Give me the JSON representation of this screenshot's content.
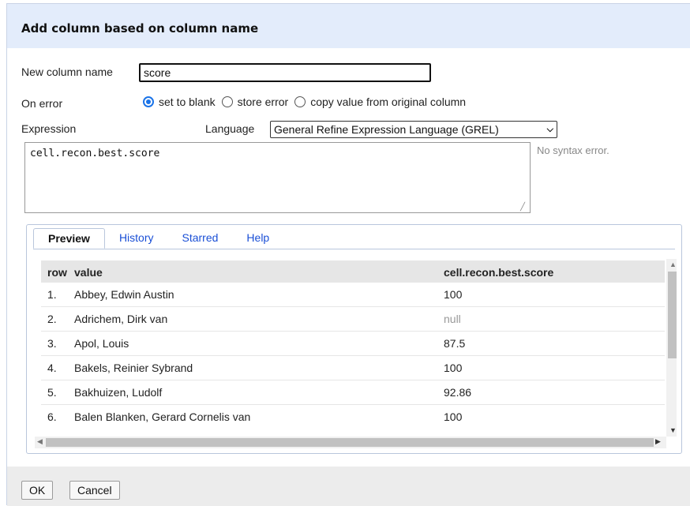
{
  "dialog": {
    "title": "Add column based on column name"
  },
  "form": {
    "new_column_label": "New column name",
    "new_column_value": "score",
    "on_error_label": "On error",
    "on_error_options": [
      "set to blank",
      "store error",
      "copy value from original column"
    ],
    "on_error_selected": "set to blank",
    "expression_label": "Expression",
    "language_label": "Language",
    "language_value": "General Refine Expression Language (GREL)",
    "expression_value": "cell.recon.best.score",
    "syntax_status": "No syntax error."
  },
  "tabs": [
    {
      "label": "Preview",
      "active": true
    },
    {
      "label": "History",
      "active": false
    },
    {
      "label": "Starred",
      "active": false
    },
    {
      "label": "Help",
      "active": false
    }
  ],
  "preview": {
    "columns": [
      "row",
      "value",
      "cell.recon.best.score"
    ],
    "rows": [
      {
        "row": "1.",
        "value": "Abbey, Edwin Austin",
        "result": "100"
      },
      {
        "row": "2.",
        "value": "Adrichem, Dirk van",
        "result": "null"
      },
      {
        "row": "3.",
        "value": "Apol, Louis",
        "result": "87.5"
      },
      {
        "row": "4.",
        "value": "Bakels, Reinier Sybrand",
        "result": "100"
      },
      {
        "row": "5.",
        "value": "Bakhuizen, Ludolf",
        "result": "92.86"
      },
      {
        "row": "6.",
        "value": "Balen Blanken, Gerard Cornelis van",
        "result": "100"
      }
    ]
  },
  "footer": {
    "ok_label": "OK",
    "cancel_label": "Cancel"
  },
  "colors": {
    "title_bar": "#e3ecfb",
    "link": "#1a4fd6",
    "radio_accent": "#1a73e8",
    "footer": "#ececec"
  }
}
